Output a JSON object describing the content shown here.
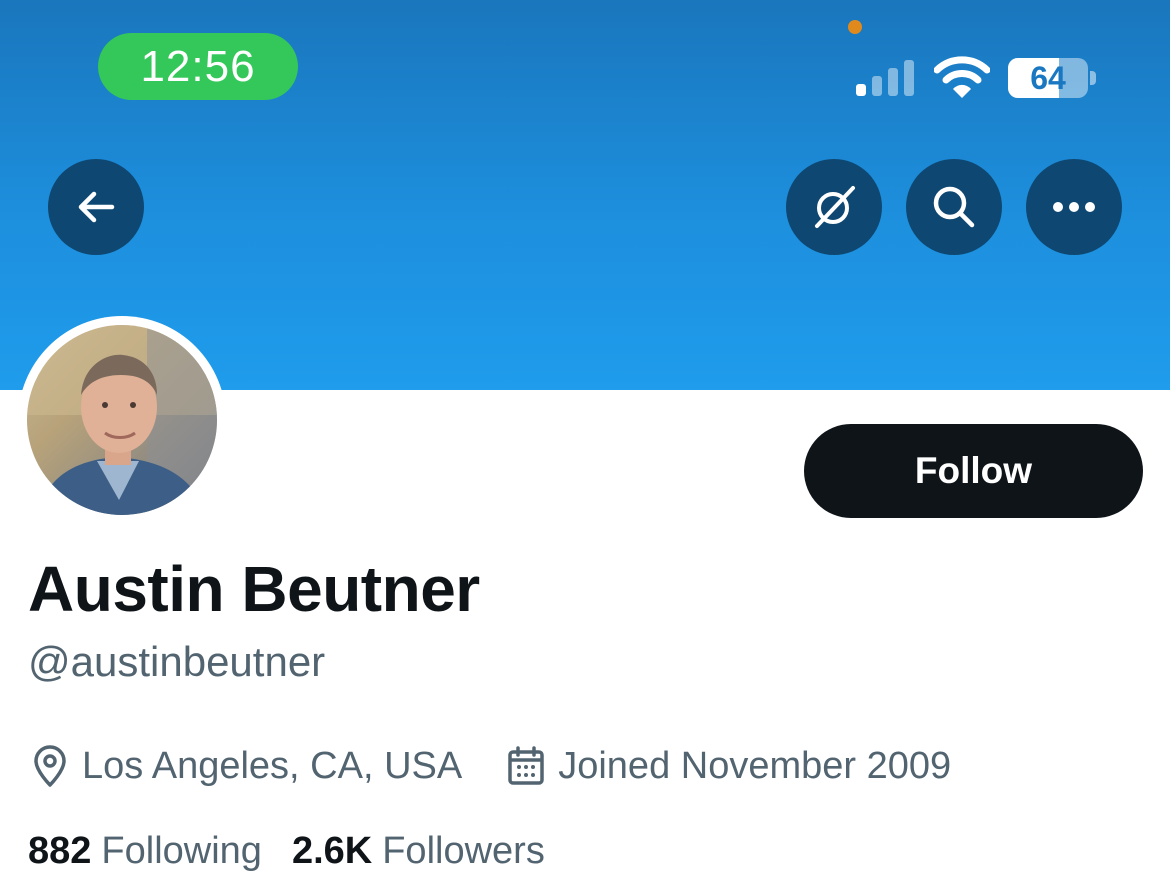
{
  "status_bar": {
    "time": "12:56",
    "battery_percent": "64",
    "battery_level": 0.64,
    "time_pill_color": "#34c759"
  },
  "header": {
    "banner_color": "#1d93e3",
    "buttons": [
      {
        "name": "back",
        "icon": "arrow-left-icon"
      },
      {
        "name": "grok",
        "icon": "slashed-circle-icon"
      },
      {
        "name": "search",
        "icon": "search-icon"
      },
      {
        "name": "more",
        "icon": "more-horizontal-icon"
      }
    ]
  },
  "profile": {
    "display_name": "Austin Beutner",
    "handle": "@austinbeutner",
    "follow_label": "Follow",
    "location": "Los Angeles, CA, USA",
    "joined": "Joined November 2009",
    "following_count": "882",
    "following_label": "Following",
    "followers_count": "2.6K",
    "followers_label": "Followers"
  },
  "colors": {
    "primary_text": "#0f1419",
    "secondary_text": "#536471",
    "button_dark": "#0f1419",
    "round_button": "#0e4872"
  }
}
